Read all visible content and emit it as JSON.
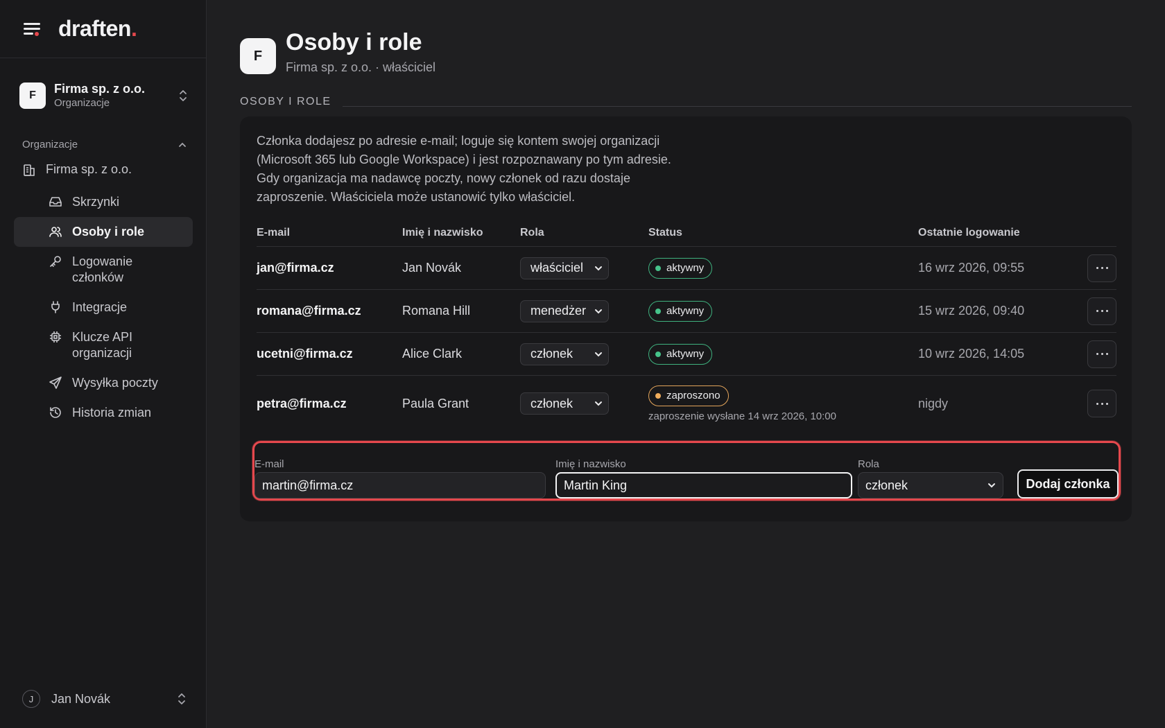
{
  "brand": {
    "name": "draften",
    "dot": "."
  },
  "sidebar": {
    "org_switch": {
      "initial": "F",
      "name": "Firma sp. z o.o.",
      "subtitle": "Organizacje"
    },
    "section_label": "Organizacje",
    "org_item": "Firma sp. z o.o.",
    "items": [
      {
        "label": "Skrzynki",
        "icon": "inbox-icon"
      },
      {
        "label": "Osoby i role",
        "icon": "users-icon",
        "active": true
      },
      {
        "label": "Logowanie członków",
        "icon": "key-icon"
      },
      {
        "label": "Integracje",
        "icon": "plug-icon"
      },
      {
        "label": "Klucze API organizacji",
        "icon": "chip-icon"
      },
      {
        "label": "Wysyłka poczty",
        "icon": "send-icon"
      },
      {
        "label": "Historia zmian",
        "icon": "history-icon"
      }
    ],
    "user": {
      "initial": "J",
      "name": "Jan Novák"
    }
  },
  "header": {
    "initial": "F",
    "title": "Osoby i role",
    "subtitle": "Firma sp. z o.o. · właściciel"
  },
  "section": {
    "title": "OSOBY I ROLE",
    "description": "Członka dodajesz po adresie e-mail; loguje się kontem swojej organizacji (Microsoft 365 lub Google Workspace) i jest rozpoznawany po tym adresie. Gdy organizacja ma nadawcę poczty, nowy członek od razu dostaje zaproszenie. Właściciela może ustanowić tylko właściciel."
  },
  "table": {
    "headers": {
      "email": "E-mail",
      "name": "Imię i nazwisko",
      "role": "Rola",
      "status": "Status",
      "last_login": "Ostatnie logowanie"
    },
    "rows": [
      {
        "email": "jan@firma.cz",
        "name": "Jan Novák",
        "role": "właściciel",
        "status": "aktywny",
        "last_login": "16 wrz 2026, 09:55"
      },
      {
        "email": "romana@firma.cz",
        "name": "Romana Hill",
        "role": "menedżer",
        "status": "aktywny",
        "last_login": "15 wrz 2026, 09:40"
      },
      {
        "email": "ucetni@firma.cz",
        "name": "Alice Clark",
        "role": "członek",
        "status": "aktywny",
        "last_login": "10 wrz 2026, 14:05"
      },
      {
        "email": "petra@firma.cz",
        "name": "Paula Grant",
        "role": "członek",
        "status": "zaproszono",
        "status_note": "zaproszenie wysłane 14 wrz 2026, 10:00",
        "last_login": "nigdy"
      }
    ]
  },
  "add_form": {
    "email_label": "E-mail",
    "email_value": "martin@firma.cz",
    "name_label": "Imię i nazwisko",
    "name_value": "Martin King",
    "role_label": "Rola",
    "role_value": "członek",
    "submit_label": "Dodaj członka"
  },
  "colors": {
    "accent_red": "#e5484d",
    "status_active": "#46c38a",
    "status_invited": "#f0ad5c"
  }
}
